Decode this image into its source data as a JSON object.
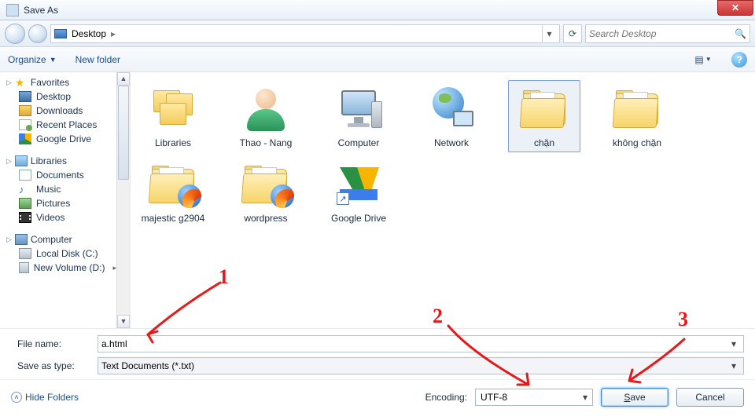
{
  "window": {
    "title": "Save As"
  },
  "nav": {
    "path_icon": "desktop",
    "path": "Desktop",
    "search_placeholder": "Search Desktop"
  },
  "toolbar": {
    "organize": "Organize",
    "new_folder": "New folder"
  },
  "sidebar": {
    "favorites": {
      "label": "Favorites",
      "items": [
        {
          "label": "Desktop",
          "icon": "desktop"
        },
        {
          "label": "Downloads",
          "icon": "downloads"
        },
        {
          "label": "Recent Places",
          "icon": "recent"
        },
        {
          "label": "Google Drive",
          "icon": "gdrive"
        }
      ]
    },
    "libraries": {
      "label": "Libraries",
      "items": [
        {
          "label": "Documents",
          "icon": "doc"
        },
        {
          "label": "Music",
          "icon": "music"
        },
        {
          "label": "Pictures",
          "icon": "pic"
        },
        {
          "label": "Videos",
          "icon": "vid"
        }
      ]
    },
    "computer": {
      "label": "Computer",
      "items": [
        {
          "label": "Local Disk (C:)",
          "icon": "disk"
        },
        {
          "label": "New Volume (D:)",
          "icon": "disk"
        }
      ]
    }
  },
  "grid": [
    {
      "label": "Libraries",
      "icon": "libraries",
      "selected": false
    },
    {
      "label": "Thao - Nang",
      "icon": "user",
      "selected": false
    },
    {
      "label": "Computer",
      "icon": "computer",
      "selected": false
    },
    {
      "label": "Network",
      "icon": "network",
      "selected": false
    },
    {
      "label": "chặn",
      "icon": "folder",
      "selected": true
    },
    {
      "label": "không chặn",
      "icon": "folder",
      "selected": false
    },
    {
      "label": "majestic g2904",
      "icon": "folder_ff",
      "selected": false
    },
    {
      "label": "wordpress",
      "icon": "folder_ff",
      "selected": false
    },
    {
      "label": "Google Drive",
      "icon": "gdrive_shortcut",
      "selected": false
    }
  ],
  "fields": {
    "filename_label": "File name:",
    "filename_value": "a.html",
    "type_label": "Save as type:",
    "type_value": "Text Documents (*.txt)"
  },
  "footer": {
    "hide_folders": "Hide Folders",
    "encoding_label": "Encoding:",
    "encoding_value": "UTF-8",
    "save": "Save",
    "cancel": "Cancel"
  },
  "annotations": {
    "n1": "1",
    "n2": "2",
    "n3": "3"
  }
}
